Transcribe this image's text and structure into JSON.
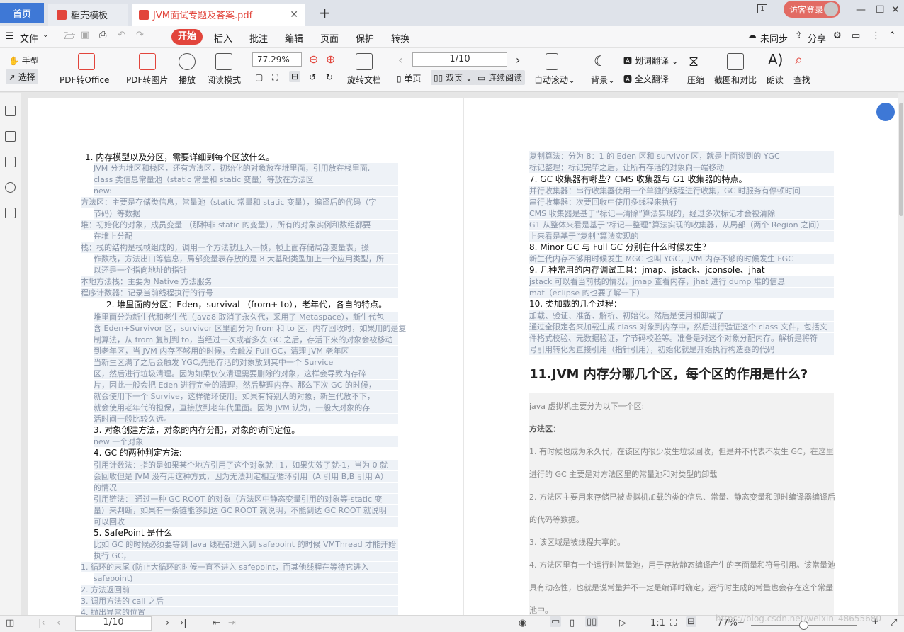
{
  "tabs": {
    "home": "首页",
    "t1": "稻壳模板",
    "t2": "JVM面试专题及答案.pdf"
  },
  "login": "访客登录",
  "menu": {
    "file": "文件",
    "start": "开始",
    "insert": "插入",
    "annot": "批注",
    "edit": "编辑",
    "page": "页面",
    "protect": "保护",
    "convert": "转换",
    "sync": "未同步",
    "share": "分享"
  },
  "toolbar": {
    "hand": "手型",
    "select": "选择",
    "pdf2office": "PDF转Office",
    "pdf2img": "PDF转图片",
    "play": "播放",
    "read": "阅读模式",
    "zoom": "77.29%",
    "page": "1/10",
    "rotate": "旋转文档",
    "single": "单页",
    "double": "双页",
    "continuous": "连续阅读",
    "autoscroll": "自动滚动",
    "bg": "背景",
    "wordtrans": "划词翻译",
    "fulltrans": "全文翻译",
    "compress": "压缩",
    "screenshot": "截图和对比",
    "readaloud": "朗读",
    "find": "查找"
  },
  "left_page": [
    "1.  内存模型以及分区，需要详细到每个区放什么。",
    "JVM 分为堆区和栈区，还有方法区，初始化的对象放在堆里面，引用放在栈里面,",
    "class 类信息常量池（static 常量和 static 变量）等放在方法区",
    "new:",
    "方法区：主要是存储类信息，常量池（static 常量和 static 变量），编译后的代码（字",
    "节码）等数据",
    "堆：初始化的对象，成员变量 （那种非 static 的变量），所有的对象实例和数组都要",
    "在堆上分配",
    "栈：栈的结构是栈帧组成的，调用一个方法就压入一帧，帧上面存储局部变量表，操",
    "作数栈，方法出口等信息，局部变量表存放的是 8 大基础类型加上一个应用类型，所",
    "以还是一个指向地址的指针",
    "本地方法栈：主要为 Native 方法服务",
    "程序计数器：记录当前线程执行的行号",
    "2.  堆里面的分区：Eden，survival （from+ to），老年代，各自的特点。",
    "堆里面分为新生代和老生代（java8 取消了永久代，采用了 Metaspace），新生代包",
    "含 Eden+Survivor 区，survivor 区里面分为 from 和 to 区，内存回收时，如果用的是复",
    "制算法，从 from 复制到 to，当经过一次或者多次 GC 之后，存活下来的对象会被移动",
    "到老年区，当 JVM 内存不够用的时候，会触发 Full GC，清理 JVM 老年区",
    "当新生区满了之后会触发 YGC,先把存活的对象放到其中一个 Survice",
    "区，然后进行垃圾清理。因为如果仅仅清理需要删除的对象，这样会导致内存碎",
    "片，因此一般会把 Eden 进行完全的清理，然后整理内存。那么下次 GC 的时候，",
    "就会使用下一个 Survive，这样循环使用。如果有特别大的对象，新生代放不下，",
    "就会使用老年代的担保，直接放到老年代里面。因为 JVM 认为，一般大对象的存",
    "活时间一般比较久远。",
    "3.  对象创建方法，对象的内存分配，对象的访问定位。",
    "new 一个对象",
    "4.  GC 的两种判定方法:",
    "引用计数法：指的是如果某个地方引用了这个对象就+1，如果失效了就-1，当为 0 就",
    "会回收但是 JVM 没有用这种方式，因为无法判定相互循环引用（A 引用 B,B 引用 A）",
    "的情况",
    "引用链法： 通过一种 GC ROOT 的对象（方法区中静态变量引用的对象等-static 变",
    "量）来判断，如果有一条链能够到达 GC ROOT 就说明，不能到达 GC ROOT 就说明",
    "可以回收",
    "5.  SafePoint 是什么",
    "比如 GC 的时候必须要等到 Java 线程都进入到 safepoint 的时候 VMThread 才能开始",
    "执行 GC，",
    "1.  循环的末尾 (防止大循环的时候一直不进入 safepoint，而其他线程在等待它进入",
    "safepoint)",
    "2.  方法返回前",
    "3.  调用方法的 call 之后",
    "4.  抛出异常的位置"
  ],
  "right_page": [
    "复制算法：分为 8：1 的 Eden 区和 survivor 区，就是上面谈到的 YGC",
    "标记整理：标记完毕之后，让所有存活的对象向一端移动",
    "7.  GC 收集器有哪些？CMS 收集器与 G1 收集器的特点。",
    "并行收集器：串行收集器使用一个单独的线程进行收集，GC 时服务有停顿时间",
    "串行收集器：次要回收中使用多线程来执行",
    "CMS 收集器是基于“标记—清除”算法实现的，经过多次标记才会被清除",
    "G1 从整体来看是基于“标记—整理”算法实现的收集器，从局部（两个 Region 之间）",
    "上来看是基于“复制”算法实现的",
    "8.  Minor GC 与 Full GC 分别在什么时候发生？",
    "新生代内存不够用时候发生 MGC 也叫 YGC，JVM 内存不够的时候发生 FGC",
    "9.  几种常用的内存调试工具：jmap、jstack、jconsole、jhat",
    "jstack 可以看当前栈的情况，jmap 查看内存，jhat 进行 dump 堆的信息",
    "mat（eclipse 的也要了解一下）",
    "10. 类加载的几个过程：",
    "加载、验证、准备、解析、初始化。然后是使用和卸载了",
    "通过全限定名来加载生成 class 对象到内存中，然后进行验证这个 class 文件，包括文",
    "件格式校验、元数据验证，字节码校验等。准备是对这个对象分配内存。解析是将符",
    "号引用转化为直接引用（指针引用），初始化就是开始执行构造器的代码"
  ],
  "h11": "11.JVM 内存分哪几个区，每个区的作用是什么?",
  "right_gray": [
    "java 虚拟机主要分为以下一个区:",
    "方法区：",
    "1. 有时候也成为永久代，在该区内很少发生垃圾回收，但是并不代表不发生 GC，在这里",
    "进行的 GC 主要是对方法区里的常量池和对类型的卸载",
    "2. 方法区主要用来存储已被虚拟机加载的类的信息、常量、静态变量和即时编译器编译后",
    "的代码等数据。",
    "3. 该区域是被线程共享的。",
    "4. 方法区里有一个运行时常量池，用于存放静态编译产生的字面量和符号引用。该常量池",
    "具有动态性，也就是说常量并不一定是编译时确定，运行时生成的常量也会存在这个常量",
    "池中。"
  ],
  "status": {
    "page": "1/10",
    "zoom": "77%"
  },
  "watermark": "https://blog.csdn.net/weixin_48655680"
}
